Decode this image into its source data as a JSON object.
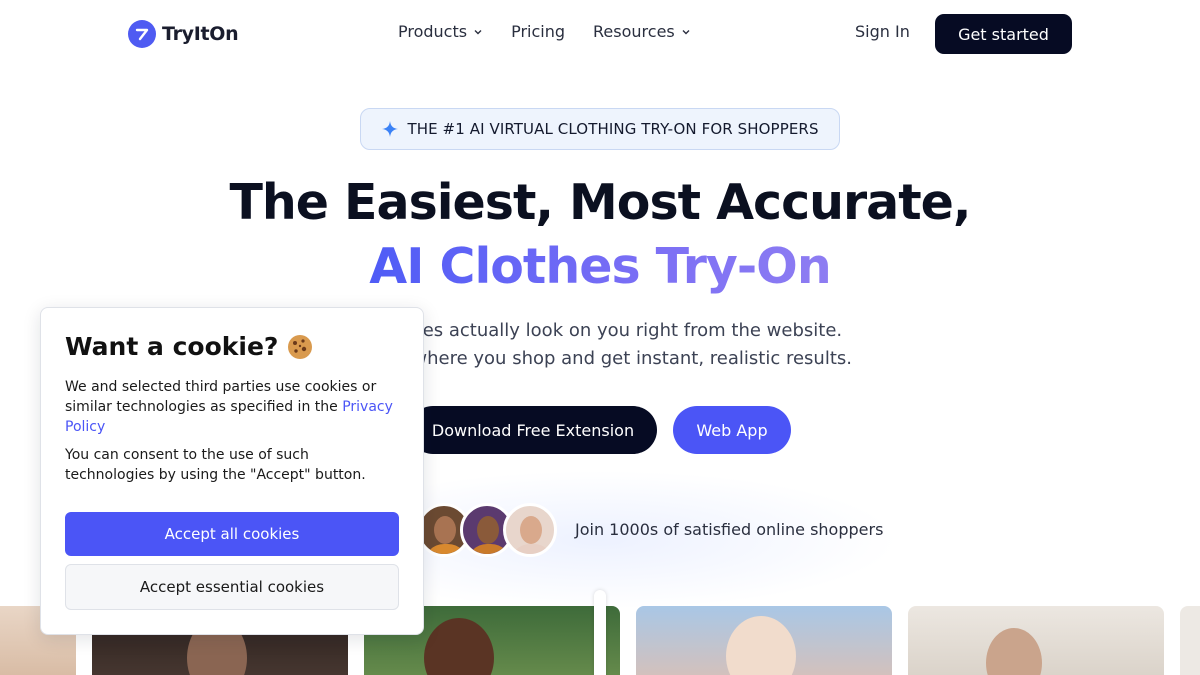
{
  "nav": {
    "logo_text": "TryItOn",
    "links": [
      {
        "label": "Products",
        "has_dropdown": true
      },
      {
        "label": "Pricing",
        "has_dropdown": false
      },
      {
        "label": "Resources",
        "has_dropdown": true
      }
    ],
    "sign_in": "Sign In",
    "get_started": "Get started"
  },
  "hero": {
    "badge": "THE #1 AI VIRTUAL CLOTHING TRY-ON FOR SHOPPERS",
    "headline_line1": "The Easiest, Most Accurate,",
    "headline_line2": "AI Clothes Try-On",
    "subtitle_line1": "w clothes actually look on you right from the website.",
    "subtitle_line2": "On anywhere you shop and get instant, realistic results.",
    "primary_cta": "Download Free Extension",
    "secondary_cta": "Web App",
    "social_proof": "Join 1000s of satisfied online shoppers"
  },
  "cookie": {
    "title": "Want a cookie?",
    "icon": "cookie-icon",
    "body1_before": "We and selected third parties use cookies or similar technologies as specified in the ",
    "body1_link": "Privacy Policy",
    "body2": "You can consent to the use of such technologies by using the \"Accept\" button.",
    "accept_all": "Accept all cookies",
    "accept_essential": "Accept essential cookies"
  },
  "colors": {
    "brand": "#4b55f6",
    "dark": "#060b23",
    "badge_bg": "#eef4fd"
  }
}
